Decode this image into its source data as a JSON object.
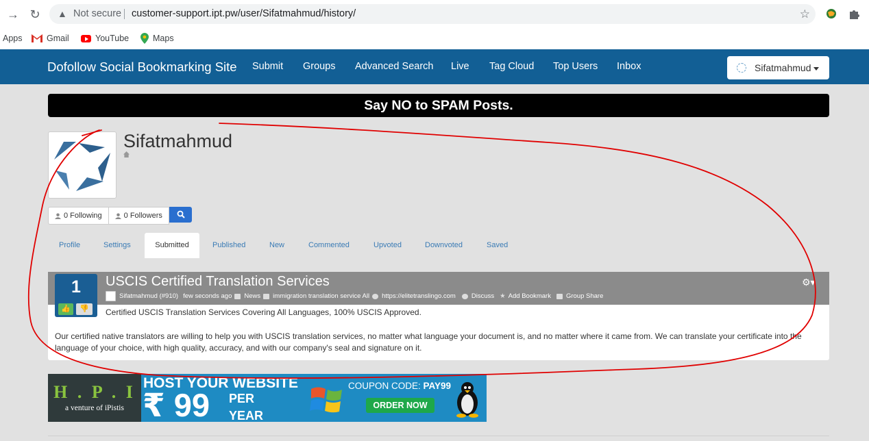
{
  "browser": {
    "security_label": "Not secure",
    "url": "customer-support.ipt.pw/user/Sifatmahmud/history/",
    "bookmarks": [
      {
        "label": "Apps"
      },
      {
        "label": "Gmail"
      },
      {
        "label": "YouTube"
      },
      {
        "label": "Maps"
      }
    ]
  },
  "navbar": {
    "brand": "Dofollow Social Bookmarking Site",
    "links": [
      "Submit",
      "Groups",
      "Advanced Search",
      "Live",
      "Tag Cloud",
      "Top Users",
      "Inbox"
    ],
    "user_menu": "Sifatmahmud"
  },
  "banner": {
    "text": "Say NO to SPAM Posts."
  },
  "profile": {
    "name": "Sifatmahmud",
    "following": "0 Following",
    "followers": "0 Followers",
    "tabs": [
      "Profile",
      "Settings",
      "Submitted",
      "Published",
      "New",
      "Commented",
      "Upvoted",
      "Downvoted",
      "Saved"
    ],
    "active_tab": "Submitted"
  },
  "story": {
    "votes": "1",
    "title": "USCIS Certified Translation Services",
    "author": "Sifatmahmud (#910)",
    "time": "few seconds ago",
    "category": "News",
    "tags": "immigration translation service All",
    "link": "https://elitetranslingo.com",
    "discuss": "Discuss",
    "add_bookmark": "Add Bookmark",
    "group_share": "Group Share",
    "subtitle": "Certified USCIS Translation Services Covering All Languages, 100% USCIS Approved.",
    "body": "Our certified native translators are willing to help you with USCIS translation services, no matter what language your document is, and no matter where it came from. We can translate your certificate into the language of your choice, with high quality, accuracy, and with our company's seal and signature on it."
  },
  "ad": {
    "logo": "H . P . I",
    "tagline": "a venture of iPistis",
    "headline": "HOST YOUR WEBSITE",
    "price": "₹ 99",
    "per": "PER",
    "year": "YEAR",
    "coupon_label": "COUPON CODE:",
    "coupon_code": "PAY99",
    "cta": "ORDER NOW"
  },
  "colors": {
    "navbar": "#125f95",
    "banner": "#000000",
    "vote_box": "#1a5e94",
    "story_header": "#8b8b8b",
    "annotation": "#e00000"
  }
}
